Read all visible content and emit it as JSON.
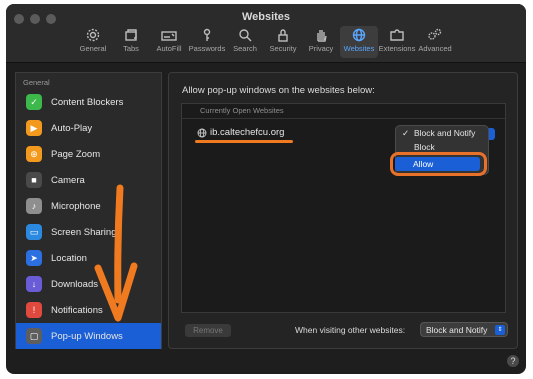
{
  "window": {
    "title": "Websites"
  },
  "toolbar": {
    "items": [
      {
        "label": "General",
        "icon": "gear-icon"
      },
      {
        "label": "Tabs",
        "icon": "tabs-icon"
      },
      {
        "label": "AutoFill",
        "icon": "autofill-icon"
      },
      {
        "label": "Passwords",
        "icon": "key-icon"
      },
      {
        "label": "Search",
        "icon": "search-icon"
      },
      {
        "label": "Security",
        "icon": "lock-icon"
      },
      {
        "label": "Privacy",
        "icon": "hand-icon"
      },
      {
        "label": "Websites",
        "icon": "globe-icon",
        "active": true
      },
      {
        "label": "Extensions",
        "icon": "puzzle-icon"
      },
      {
        "label": "Advanced",
        "icon": "gears-icon"
      }
    ]
  },
  "sidebar": {
    "header": "General",
    "items": [
      {
        "label": "Content Blockers",
        "color": "#3cb94a",
        "glyph": "✓"
      },
      {
        "label": "Auto-Play",
        "color": "#f39a1e",
        "glyph": "▶"
      },
      {
        "label": "Page Zoom",
        "color": "#f39a1e",
        "glyph": "⊕"
      },
      {
        "label": "Camera",
        "color": "#4a4a4a",
        "glyph": "■"
      },
      {
        "label": "Microphone",
        "color": "#8e8e8e",
        "glyph": "♪"
      },
      {
        "label": "Screen Sharing",
        "color": "#2b8ae0",
        "glyph": "▭"
      },
      {
        "label": "Location",
        "color": "#2b6fe0",
        "glyph": "➤"
      },
      {
        "label": "Downloads",
        "color": "#6a5cd6",
        "glyph": "↓"
      },
      {
        "label": "Notifications",
        "color": "#e04a3e",
        "glyph": "!"
      },
      {
        "label": "Pop-up Windows",
        "color": "#5e5e5e",
        "glyph": "▢",
        "selected": true
      }
    ]
  },
  "main": {
    "title": "Allow pop-up windows on the websites below:",
    "table_header": "Currently Open Websites",
    "website": "ib.caltechefcu.org",
    "dropdown": {
      "options": [
        "Block and Notify",
        "Block",
        "Allow"
      ],
      "checked": "Block and Notify",
      "highlighted": "Allow"
    },
    "remove_label": "Remove",
    "other_label": "When visiting other websites:",
    "other_value": "Block and Notify"
  },
  "help": "?",
  "colors": {
    "accent": "#1a5fd6",
    "annotation": "#f07a1f"
  }
}
